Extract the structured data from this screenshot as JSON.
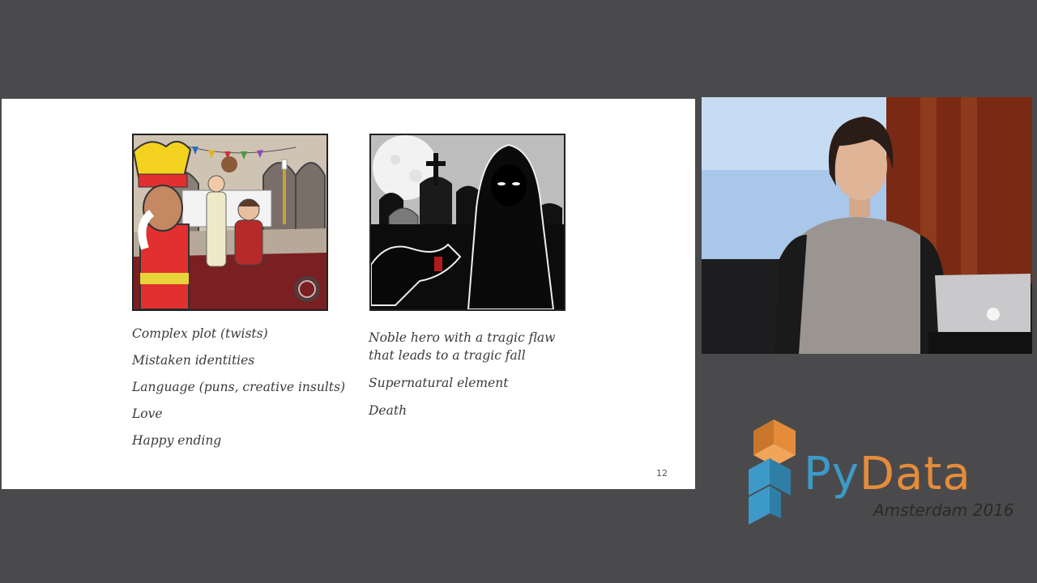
{
  "slide": {
    "left_list": [
      "Complex plot (twists)",
      "Mistaken identities",
      "Language (puns, creative insults)",
      "Love",
      "Happy ending"
    ],
    "right_list": [
      "Noble hero with a tragic flaw that leads to a tragic fall",
      "Supernatural element",
      "Death"
    ],
    "page_number": "12"
  },
  "logo": {
    "py": "Py",
    "data": "Data",
    "subtitle": "Amsterdam 2016"
  },
  "colors": {
    "background": "#4a4a4c",
    "logo_blue": "#3d9ac8",
    "logo_orange": "#e58c3a"
  }
}
